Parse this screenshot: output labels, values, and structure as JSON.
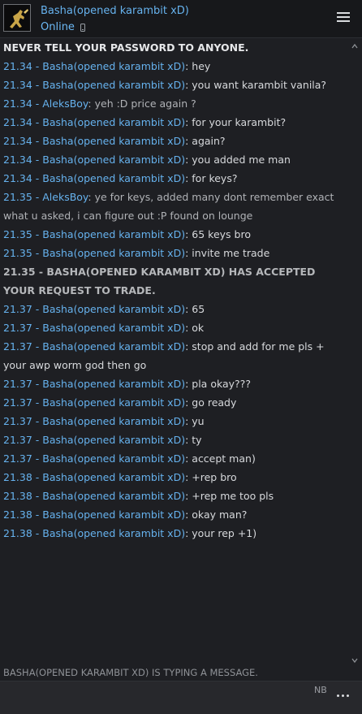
{
  "header": {
    "contact_name": "Basha(opened karambit xD)",
    "status": "Online"
  },
  "chat": {
    "warning": "NEVER TELL YOUR PASSWORD TO ANYONE.",
    "messages": [
      {
        "meta": "21.34 - Basha(opened karambit xD)",
        "text": ": hey"
      },
      {
        "meta": "21.34 - Basha(opened karambit xD)",
        "text": ": you want karambit vanila?"
      },
      {
        "meta": "21.34 - AleksBoy",
        "text": ": yeh :D price again ?"
      },
      {
        "meta": "21.34 - Basha(opened karambit xD)",
        "text": ": for your karambit?"
      },
      {
        "meta": "21.34 - Basha(opened karambit xD)",
        "text": ": again?"
      },
      {
        "meta": "21.34 - Basha(opened karambit xD)",
        "text": ": you added me man"
      },
      {
        "meta": "21.34 - Basha(opened karambit xD)",
        "text": ": for keys?"
      },
      {
        "meta": "21.35 - AleksBoy",
        "text": ": ye for keys, added many dont remember exact what u asked, i can figure out :P found on lounge"
      },
      {
        "meta": "21.35 - Basha(opened karambit xD)",
        "text": ": 65 keys bro"
      },
      {
        "meta": "21.35 - Basha(opened karambit xD)",
        "text": ": invite me trade"
      },
      {
        "system": "21.35 - BASHA(OPENED KARAMBIT XD) HAS ACCEPTED YOUR REQUEST TO TRADE."
      },
      {
        "meta": "21.37 - Basha(opened karambit xD)",
        "text": ": 65"
      },
      {
        "meta": "21.37 - Basha(opened karambit xD)",
        "text": ": ok"
      },
      {
        "meta": "21.37 - Basha(opened karambit xD)",
        "text": ": stop and add for me pls + your awp worm god then go"
      },
      {
        "meta": "21.37 - Basha(opened karambit xD)",
        "text": ": pla okay???"
      },
      {
        "meta": "21.37 - Basha(opened karambit xD)",
        "text": ": go ready"
      },
      {
        "meta": "21.37 - Basha(opened karambit xD)",
        "text": ": yu"
      },
      {
        "meta": "21.37 - Basha(opened karambit xD)",
        "text": ": ty"
      },
      {
        "meta": "21.37 - Basha(opened karambit xD)",
        "text": ": accept man)"
      },
      {
        "meta": "21.38 - Basha(opened karambit xD)",
        "text": ": +rep bro"
      },
      {
        "meta": "21.38 - Basha(opened karambit xD)",
        "text": ": +rep me too pls"
      },
      {
        "meta": "21.38 - Basha(opened karambit xD)",
        "text": ": okay man?"
      },
      {
        "meta": "21.38 - Basha(opened karambit xD)",
        "text": ": your rep +1)"
      }
    ]
  },
  "footer": {
    "typing_status": "BASHA(OPENED KARAMBIT XD) IS TYPING A MESSAGE.",
    "nb_label": "NB",
    "input_value": ""
  },
  "icons": {
    "phone": "phone-icon",
    "menu": "hamburger-icon",
    "more": "more-icon",
    "scroll_up": "chevron-up-icon",
    "scroll_down": "chevron-down-icon"
  },
  "colors": {
    "background": "#1e1f23",
    "header": "#17181b",
    "name_blue": "#66b2ee",
    "text": "#d7d9dc",
    "system": "#b5b7ba"
  }
}
